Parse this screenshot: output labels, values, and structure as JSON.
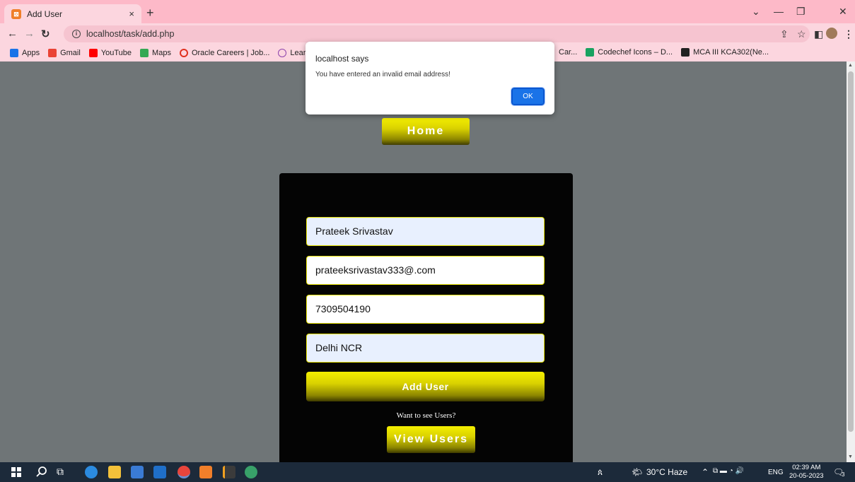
{
  "browser": {
    "tab_title": "Add User",
    "tab_close": "×",
    "new_tab": "+",
    "url": "localhost/task/add.php",
    "bookmarks": [
      {
        "label": "Apps",
        "color": "#1a73e8"
      },
      {
        "label": "Gmail",
        "color": "#ea4335"
      },
      {
        "label": "YouTube",
        "color": "#ff0000"
      },
      {
        "label": "Maps",
        "color": "#34a853"
      },
      {
        "label": "Oracle Careers | Job...",
        "color": "#e0301e"
      },
      {
        "label": "Learn how",
        "color": "#8e44ad"
      }
    ],
    "bookmarks_right": [
      {
        "label": "Car...",
        "color": ""
      },
      {
        "label": "Codechef Icons – D...",
        "color": "#1aa260"
      },
      {
        "label": "MCA III KCA302(Ne...",
        "color": "#222222"
      }
    ]
  },
  "page": {
    "home_label": "Home",
    "fields": {
      "name": "Prateek Srivastav",
      "email": "prateeksrivastav333@.com",
      "phone": "7309504190",
      "address": "Delhi NCR"
    },
    "add_user_label": "Add User",
    "see_users_text": "Want to see Users?",
    "view_users_label": "View Users"
  },
  "dialog": {
    "title": "localhost says",
    "message": "You have entered an invalid email address!",
    "ok_label": "OK"
  },
  "taskbar": {
    "weather": "30°C Haze",
    "lang": "ENG",
    "time": "02:39 AM",
    "date": "20-05-2023",
    "notif_count": "3"
  },
  "colors": {
    "accent_gold": "#d9d100",
    "page_bg": "#6f7577",
    "card_bg": "#040404",
    "tab_bar": "#fdb9c8"
  }
}
